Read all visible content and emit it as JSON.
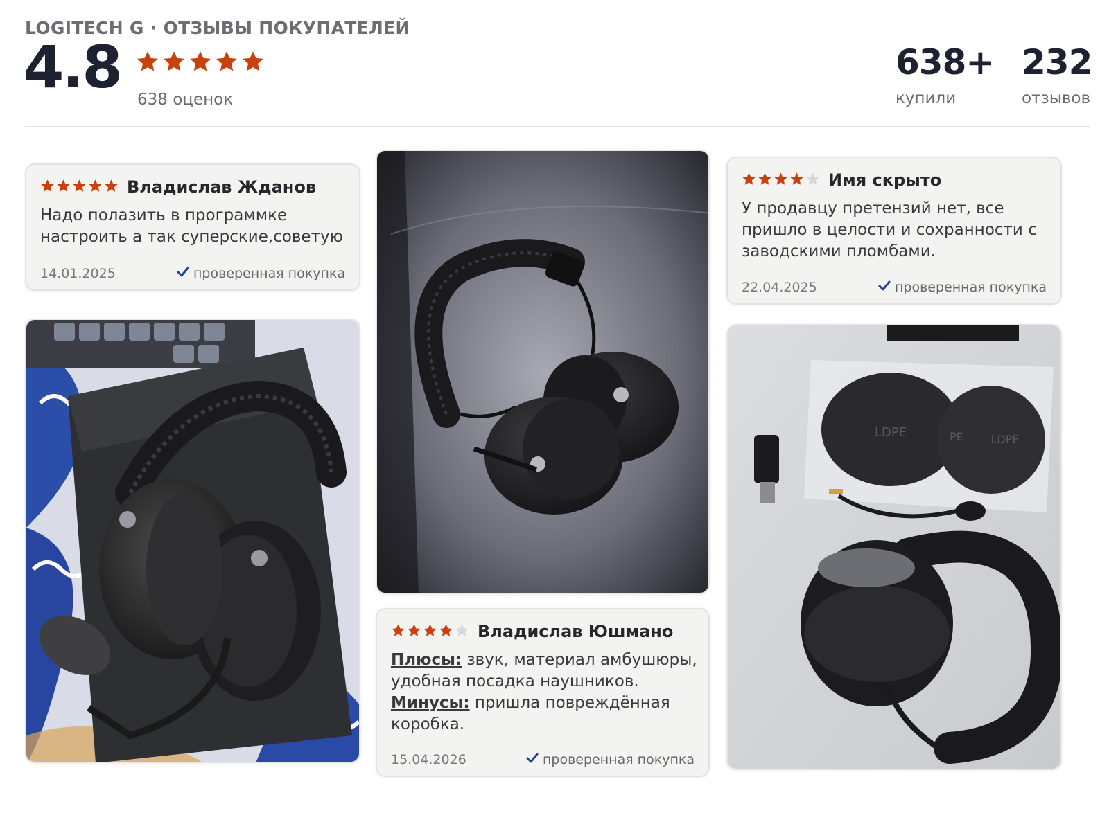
{
  "header": {
    "brand_title": "LOGITECH G · ОТЗЫВЫ ПОКУПАТЕЛЕЙ",
    "score": "4.8",
    "score_stars": 5,
    "ratings_count": "638 оценок",
    "bought_value": "638+",
    "bought_label": "купили",
    "reviews_value": "232",
    "reviews_label": "отзывов"
  },
  "colors": {
    "star": "#c8420e",
    "star_empty": "#d8d8d8",
    "verified_check": "#23418f"
  },
  "reviews": [
    {
      "author": "Владислав Жданов",
      "rating": 5,
      "text": "Надо полазить в программке настроить а так суперские,советую",
      "date": "14.01.2025",
      "verified": "проверенная покупка"
    },
    {
      "author": "Владислав Юшмано",
      "rating": 4,
      "pros_label": "Плюсы:",
      "pros": " звук, материал амбушюры, удобная посадка наушников.",
      "cons_label": "Минусы:",
      "cons": " пришла повреждённая коробка.",
      "date": "15.04.2026",
      "verified": "проверенная покупка"
    },
    {
      "author": "Имя скрыто",
      "rating": 4,
      "text": "У продавцу претензий нет, все пришло в целости и сохранности с заводскими пломбами.",
      "date": "22.04.2025",
      "verified": "проверенная покупка"
    }
  ],
  "photos": [
    {
      "name": "photo-headset-on-bag"
    },
    {
      "name": "photo-headset-on-leather"
    },
    {
      "name": "photo-headset-accessories"
    }
  ],
  "photo_labels": [
    "LDPE",
    "PE",
    "LDPE"
  ]
}
